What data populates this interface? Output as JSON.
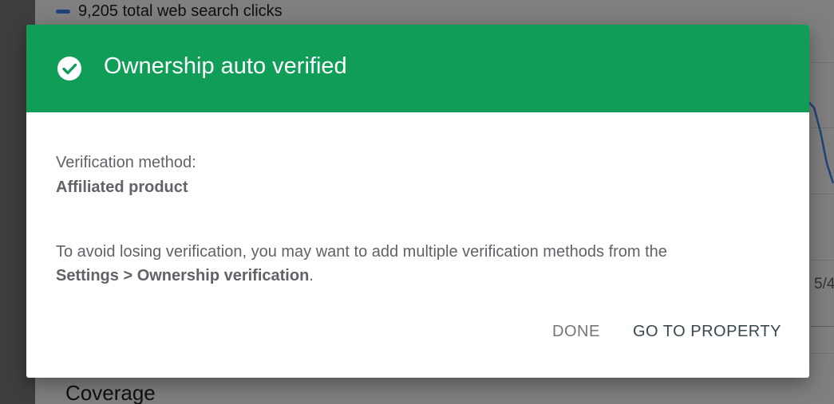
{
  "background": {
    "legend_text": "9,205 total web search clicks",
    "x_tick_partial": "5/4",
    "section_title": "Coverage"
  },
  "dialog": {
    "title": "Ownership auto verified",
    "header_color": "#0f9d58",
    "header_icon": "check-circle-icon",
    "method_label": "Verification method:",
    "method_value": "Affiliated product",
    "advice_text": "To avoid losing verification, you may want to add multiple verification methods from the",
    "advice_link": "Settings > Ownership verification",
    "advice_suffix": ".",
    "buttons": {
      "done": "DONE",
      "go_to_property": "GO TO PROPERTY"
    }
  }
}
